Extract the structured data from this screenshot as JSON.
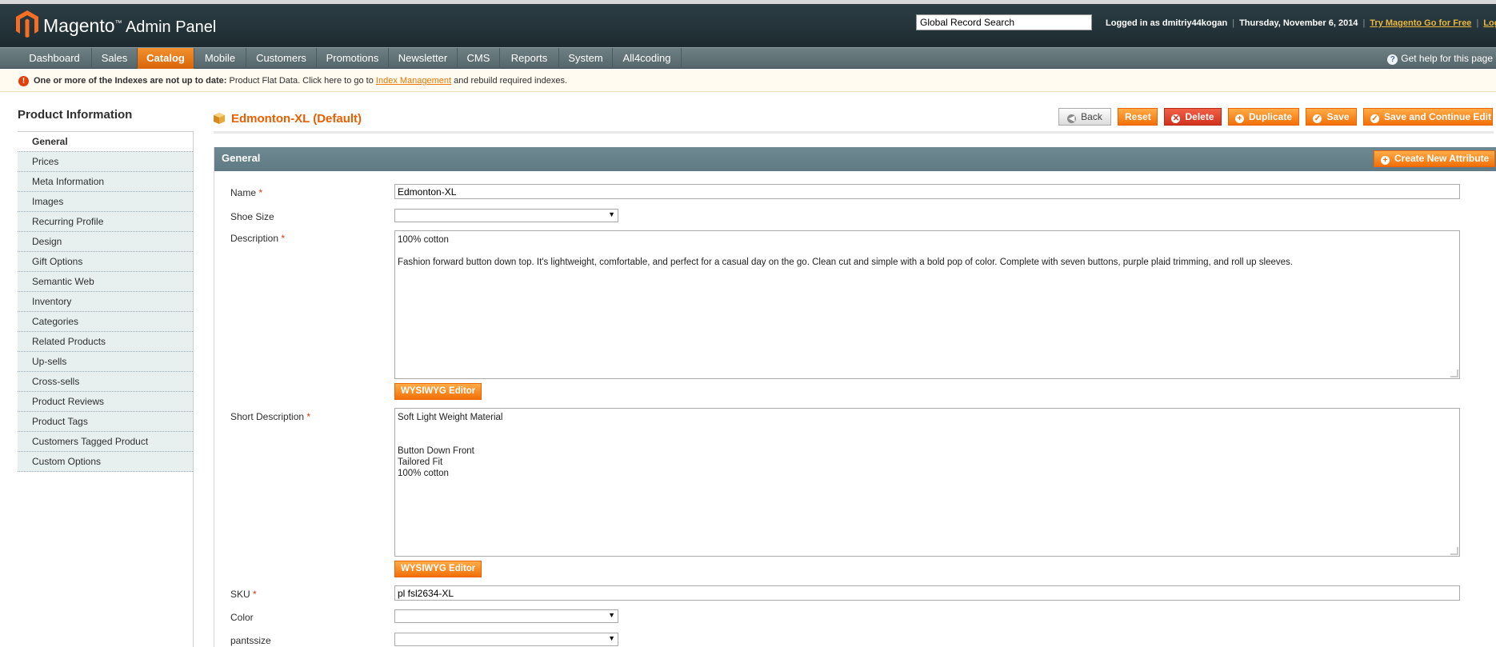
{
  "header": {
    "logo_main": "Magento",
    "logo_tm": "™",
    "logo_sub": " Admin Panel",
    "search_value": "Global Record Search",
    "logged_in": "Logged in as dmitriy44kogan",
    "date": "Thursday, November 6, 2014",
    "try_link": "Try Magento Go for Free",
    "logout": "Log Out"
  },
  "nav": {
    "items": [
      "Dashboard",
      "Sales",
      "Catalog",
      "Mobile",
      "Customers",
      "Promotions",
      "Newsletter",
      "CMS",
      "Reports",
      "System",
      "All4coding"
    ],
    "active": "Catalog",
    "help": "Get help for this page"
  },
  "notice": {
    "bold": "One or more of the Indexes are not up to date:",
    "text": " Product Flat Data. Click here to go to ",
    "link": "Index Management",
    "tail": " and rebuild required indexes."
  },
  "sidebar": {
    "title": "Product Information",
    "items": [
      "General",
      "Prices",
      "Meta Information",
      "Images",
      "Recurring Profile",
      "Design",
      "Gift Options",
      "Semantic Web",
      "Inventory",
      "Categories",
      "Related Products",
      "Up-sells",
      "Cross-sells",
      "Product Reviews",
      "Product Tags",
      "Customers Tagged Product",
      "Custom Options"
    ],
    "active": "General"
  },
  "page": {
    "title": "Edmonton-XL (Default)",
    "buttons": {
      "back": "Back",
      "reset": "Reset",
      "delete": "Delete",
      "duplicate": "Duplicate",
      "save": "Save",
      "save_continue": "Save and Continue Edit"
    }
  },
  "section": {
    "title": "General",
    "create_attr": "Create New Attribute"
  },
  "form": {
    "name_label": "Name",
    "name_value": "Edmonton-XL",
    "shoe_size_label": "Shoe Size",
    "description_label": "Description",
    "description_value": "100% cotton\n\nFashion forward button down top. It's lightweight, comfortable, and perfect for a casual day on the go. Clean cut and simple with a bold pop of color. Complete with seven buttons, purple plaid trimming, and roll up sleeves.",
    "wysiwyg": "WYSIWYG Editor",
    "short_description_label": "Short Description",
    "short_description_value": "Soft Light Weight Material\n\n\nButton Down Front\nTailored Fit\n100% cotton",
    "sku_label": "SKU",
    "sku_value": "pl fsl2634-XL",
    "color_label": "Color",
    "pantssize_label": "pantssize",
    "required_mark": " *"
  },
  "colors": {
    "accent": "#eb5e00",
    "button_orange": "#f26f07",
    "header_bg": "#23353b",
    "section_head": "#6a838c"
  }
}
